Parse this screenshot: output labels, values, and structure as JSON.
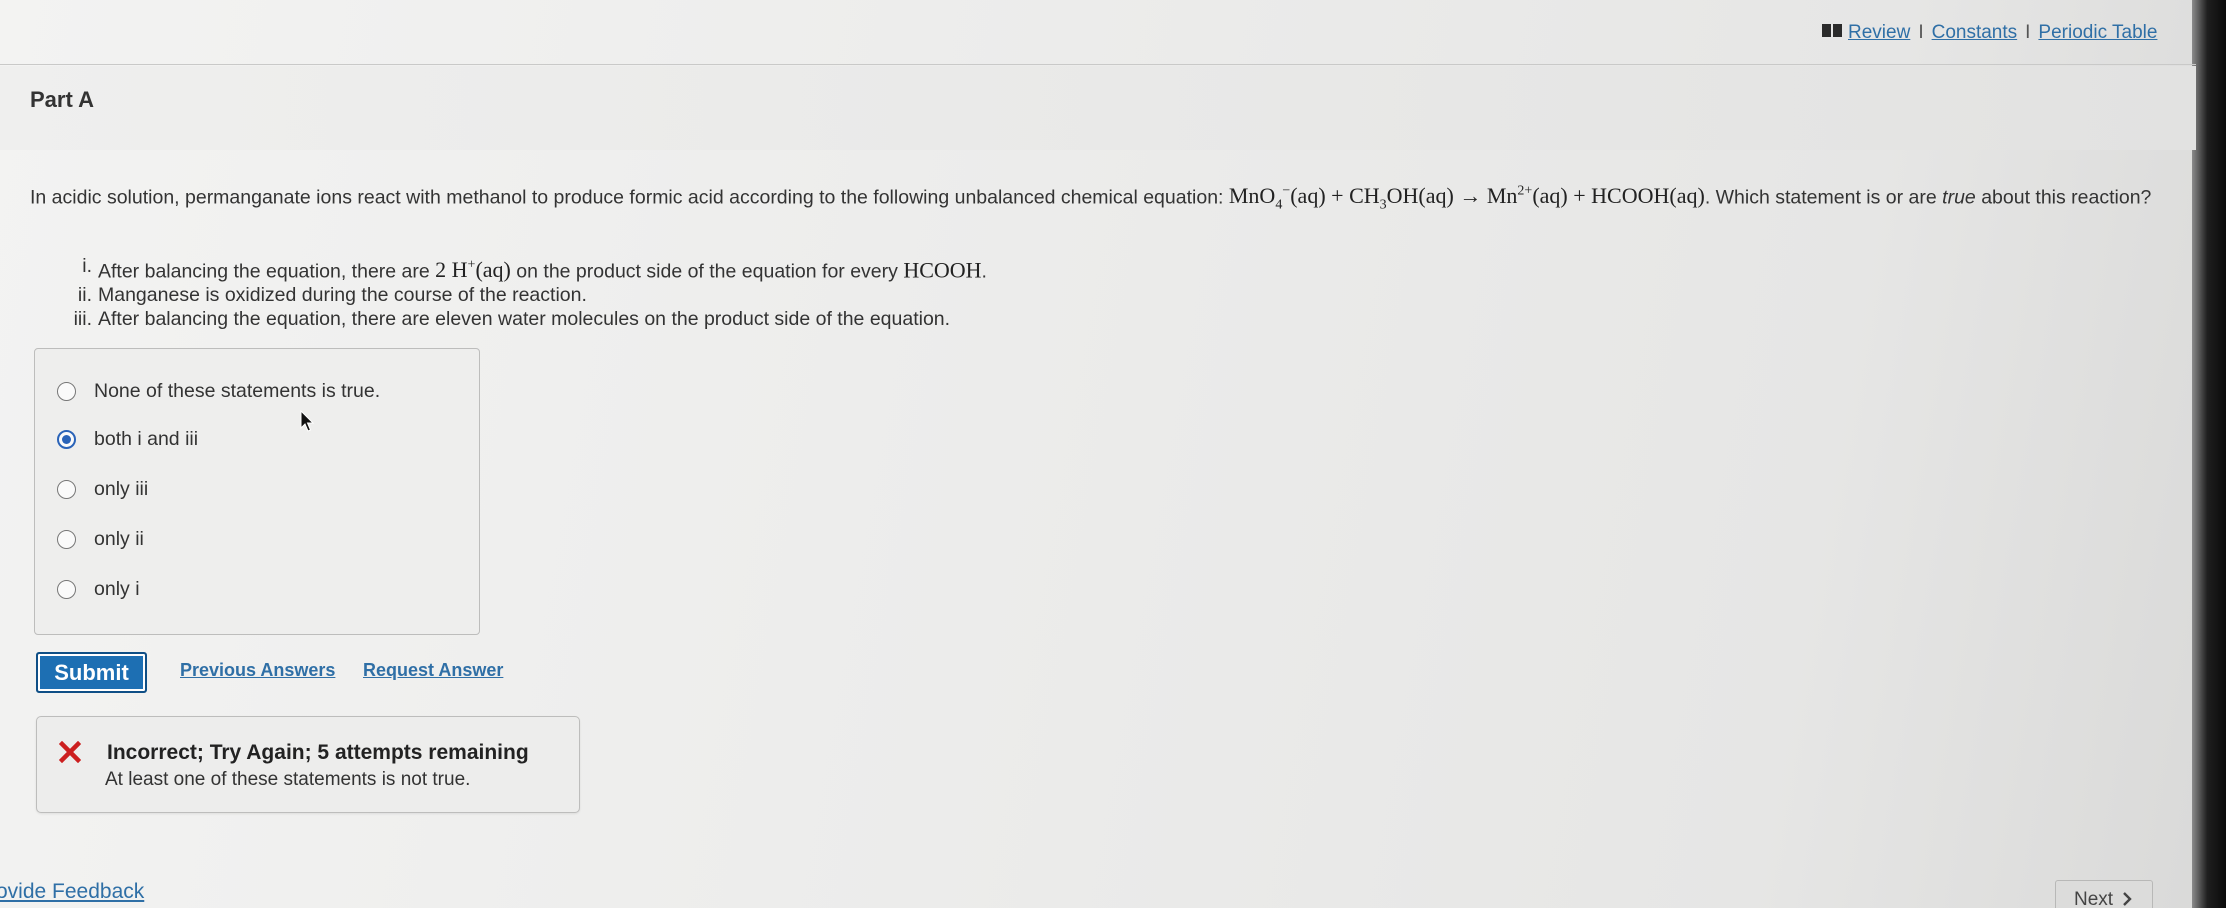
{
  "header": {
    "links": [
      {
        "label": "Review"
      },
      {
        "label": "Constants"
      },
      {
        "label": "Periodic Table"
      }
    ],
    "separator": "I"
  },
  "part": {
    "title": "Part A"
  },
  "question": {
    "intro": "In acidic solution, permanganate ions react with methanol to produce formic acid according to the following unbalanced chemical equation:",
    "equation": {
      "reactant1_base": "MnO",
      "reactant1_sub": "4",
      "reactant1_sup": "−",
      "aq": "(aq)",
      "plus": "+",
      "reactant2_a": "CH",
      "reactant2_sub": "3",
      "reactant2_b": "OH",
      "arrow": "→",
      "product1_base": "Mn",
      "product1_sup": "2+",
      "product2": "HCOOH"
    },
    "tail_before": ". Which statement is or are",
    "tail_emph": "true",
    "tail_after": "about this reaction?"
  },
  "statements": [
    {
      "num": "i.",
      "pre": "After balancing the equation, there are",
      "math_a": "2 H",
      "math_sup": "+",
      "math_b": "(aq)",
      "mid": "on the product side of the equation for every",
      "math_c": "HCOOH",
      "end": "."
    },
    {
      "num": "ii.",
      "text": "Manganese is oxidized during the course of the reaction."
    },
    {
      "num": "iii.",
      "text": "After balancing the equation, there are eleven water molecules on the product side of the equation."
    }
  ],
  "options": [
    {
      "label": "None of these statements is true.",
      "selected": false
    },
    {
      "label": "both i and iii",
      "selected": true
    },
    {
      "label": "only iii",
      "selected": false
    },
    {
      "label": "only ii",
      "selected": false
    },
    {
      "label": "only i",
      "selected": false
    }
  ],
  "actions": {
    "submit": "Submit",
    "previous_answers": "Previous Answers",
    "request_answer": "Request Answer"
  },
  "feedback": {
    "title": "Incorrect; Try Again; 5 attempts remaining",
    "message": "At least one of these statements is not true."
  },
  "footer": {
    "provide_feedback": "ovide Feedback",
    "next": "Next"
  },
  "colors": {
    "link": "#2f6fa6",
    "submit_bg": "#1d6fb3",
    "radio_selected": "#2a63b8",
    "error_icon": "#cc1f1f"
  },
  "icons": {
    "header": "book-icon",
    "feedback": "x-mark-icon",
    "next": "chevron-right-icon"
  }
}
